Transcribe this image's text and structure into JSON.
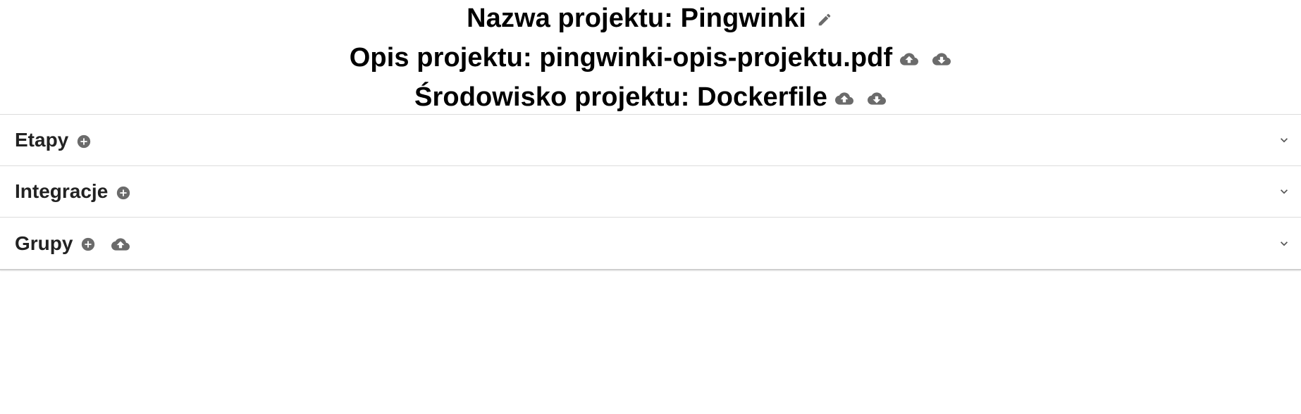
{
  "project": {
    "name_line": "Nazwa projektu: Pingwinki",
    "description_line": "Opis projektu: pingwinki-opis-projektu.pdf",
    "environment_line": "Środowisko projektu: Dockerfile"
  },
  "sections": {
    "stages": {
      "title": "Etapy"
    },
    "integrations": {
      "title": "Integracje"
    },
    "groups": {
      "title": "Grupy"
    }
  },
  "icons": {
    "edit": "pencil-icon",
    "upload": "cloud-upload-icon",
    "download": "cloud-download-icon",
    "add": "add-circle-icon",
    "expand": "chevron-down-icon"
  },
  "colors": {
    "icon_gray": "#6b6b6b",
    "text_dark": "#222222",
    "border": "#dcdcdc"
  }
}
